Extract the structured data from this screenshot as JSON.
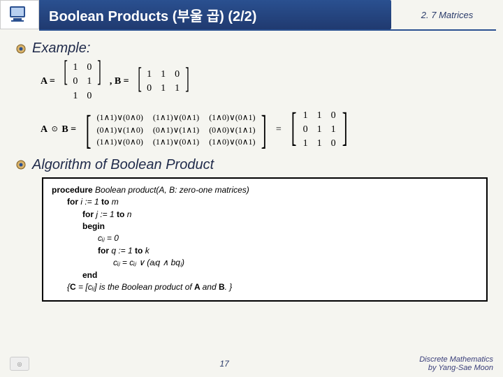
{
  "header": {
    "title": "Boolean Products (부울 곱) (2/2)",
    "section": "2. 7 Matrices"
  },
  "bullets": {
    "example": "Example:",
    "algorithm": "Algorithm of Boolean Product"
  },
  "math": {
    "A_def": "A =",
    "B_def": ", B =",
    "A": [
      [
        "1",
        "0"
      ],
      [
        "0",
        "1"
      ],
      [
        "1",
        "0"
      ]
    ],
    "B": [
      [
        "1",
        "1",
        "0"
      ],
      [
        "0",
        "1",
        "1"
      ]
    ],
    "AB_label_left": "A",
    "AB_op": "⊙",
    "AB_label_right": "B  =",
    "equals": "=",
    "AB_expr": [
      [
        "(1∧1)∨(0∧0)",
        "(1∧1)∨(0∧1)",
        "(1∧0)∨(0∧1)"
      ],
      [
        "(0∧1)∨(1∧0)",
        "(0∧1)∨(1∧1)",
        "(0∧0)∨(1∧1)"
      ],
      [
        "(1∧1)∨(0∧0)",
        "(1∧1)∨(0∧1)",
        "(1∧0)∨(0∧1)"
      ]
    ],
    "AB_result": [
      [
        "1",
        "1",
        "0"
      ],
      [
        "0",
        "1",
        "1"
      ],
      [
        "1",
        "1",
        "0"
      ]
    ]
  },
  "algo": {
    "line1_pre": "procedure ",
    "line1_mid": "Boolean product",
    "line1_post": "(A, B: zero-one matrices)",
    "line2a": "for ",
    "line2b": "i := 1 ",
    "line2c": "to ",
    "line2d": "m",
    "line3a": "for ",
    "line3b": "j := 1 ",
    "line3c": "to ",
    "line3d": "n",
    "line4": "begin",
    "line5": "cᵢⱼ = 0",
    "line6a": "for ",
    "line6b": "q := 1 ",
    "line6c": "to ",
    "line6d": "k",
    "line7": "cᵢⱼ = cᵢⱼ ∨ (aᵢq ∧ bqⱼ)",
    "line8": "end",
    "line9a": "{",
    "line9b": "C ",
    "line9c": "= [cᵢⱼ] is the Boolean product of ",
    "line9d": "A ",
    "line9e": "and ",
    "line9f": "B",
    "line9g": ". }"
  },
  "footer": {
    "page": "17",
    "credit_l1": "Discrete Mathematics",
    "credit_l2": "by Yang-Sae Moon"
  }
}
